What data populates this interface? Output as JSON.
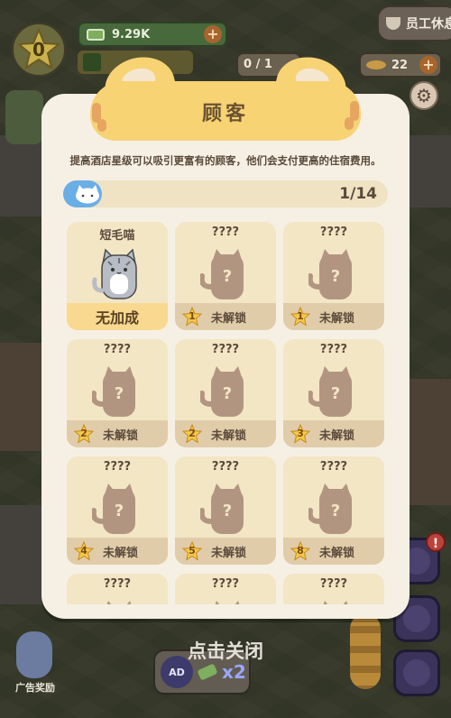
{
  "hud": {
    "star_level": "0",
    "money": "9.29K",
    "money_plus": "+",
    "staff_break": "员工休息",
    "fish_count": "22",
    "fish_plus": "+",
    "customer_count": "0 / 1"
  },
  "modal": {
    "title": "顾客",
    "description": "提高酒店星级可以吸引更富有的顾客，他们会支付更高的住宿费用。",
    "progress_text": "1/14",
    "progress_fraction": 0.071,
    "close_hint": "点击关闭",
    "settings_icon": "gear-icon",
    "cards": [
      {
        "name": "短毛喵",
        "unlocked": true,
        "footer": "无加成"
      },
      {
        "name": "????",
        "unlocked": false,
        "star": "1",
        "footer": "未解锁"
      },
      {
        "name": "????",
        "unlocked": false,
        "star": "1",
        "footer": "未解锁"
      },
      {
        "name": "????",
        "unlocked": false,
        "star": "2",
        "footer": "未解锁"
      },
      {
        "name": "????",
        "unlocked": false,
        "star": "2",
        "footer": "未解锁"
      },
      {
        "name": "????",
        "unlocked": false,
        "star": "3",
        "footer": "未解锁"
      },
      {
        "name": "????",
        "unlocked": false,
        "star": "4",
        "footer": "未解锁"
      },
      {
        "name": "????",
        "unlocked": false,
        "star": "5",
        "footer": "未解锁"
      },
      {
        "name": "????",
        "unlocked": false,
        "star": "8",
        "footer": "未解锁"
      },
      {
        "name": "????",
        "unlocked": false,
        "star": "",
        "footer": ""
      },
      {
        "name": "????",
        "unlocked": false,
        "star": "",
        "footer": ""
      },
      {
        "name": "????",
        "unlocked": false,
        "star": "",
        "footer": ""
      }
    ]
  },
  "bottom": {
    "ad_reward_label": "广告奖励",
    "ad_badge": "AD",
    "multiplier": "x2"
  },
  "colors": {
    "panel_bg": "#f6f0e4",
    "card_bg": "#f3e6c5",
    "card_footer": "#e1ccaa",
    "silhouette": "#b29581",
    "accent_yellow": "#f7d374",
    "progress_blue": "#6aaee6"
  }
}
